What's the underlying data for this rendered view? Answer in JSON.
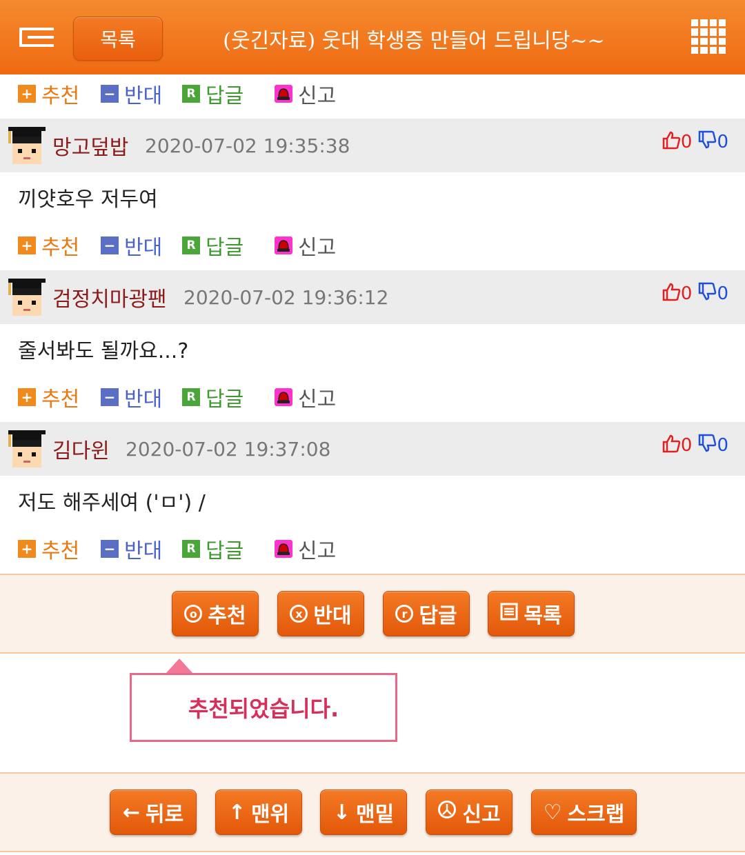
{
  "header": {
    "list_label": "목록",
    "title": "(웃긴자료) 웃대 학생증 만들어 드립니당~~"
  },
  "actions": {
    "recommend": "추천",
    "oppose": "반대",
    "reply": "답글",
    "report": "신고",
    "reply_badge": "R",
    "recommend_badge": "+",
    "oppose_badge": "−"
  },
  "comments": [
    {
      "author": "망고덮밥",
      "date": "2020-07-02 19:35:38",
      "up": "0",
      "down": "0",
      "text": "끼얏호우 저두여"
    },
    {
      "author": "검정치마광팬",
      "date": "2020-07-02 19:36:12",
      "up": "0",
      "down": "0",
      "text": "줄서봐도 될까요...?"
    },
    {
      "author": "김다윈",
      "date": "2020-07-02 19:37:08",
      "up": "0",
      "down": "0",
      "text": "저도 해주세여 ('ㅁ') /"
    }
  ],
  "vote_bar": {
    "recommend": "추천",
    "oppose": "반대",
    "reply": "답글",
    "list": "목록",
    "recommend_icon": "o",
    "oppose_icon": "x",
    "reply_icon": "r"
  },
  "tooltip": {
    "message": "추천되었습니다."
  },
  "nav_bar": {
    "back": "뒤로",
    "top": "맨위",
    "bottom": "맨밑",
    "report": "신고",
    "scrap": "스크랩",
    "back_arrow": "←",
    "top_arrow": "↑",
    "bottom_arrow": "↓",
    "scrap_heart": "♡"
  }
}
